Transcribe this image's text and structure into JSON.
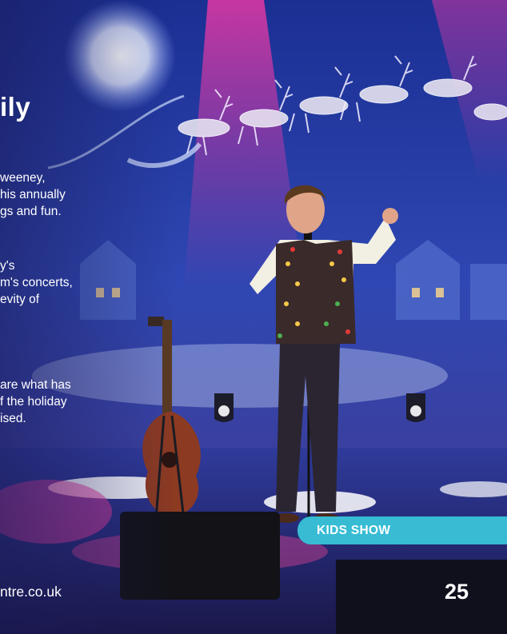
{
  "article": {
    "heading": "ily",
    "paragraph_1": [
      "weeney,",
      "his annually",
      "gs and fun."
    ],
    "paragraph_2": [
      "y's",
      "m's concerts,",
      "evity of"
    ],
    "paragraph_3": [
      "are what has",
      "f the holiday",
      "ised."
    ]
  },
  "badge": {
    "label": "KIDS SHOW",
    "color": "#37bcd4"
  },
  "footer": {
    "url_fragment": "ntre.co.uk",
    "page_number": "25"
  },
  "colors": {
    "stage_blue": "#2a3fa0",
    "spotlight_pink": "#c0307a",
    "text": "#ffffff"
  }
}
